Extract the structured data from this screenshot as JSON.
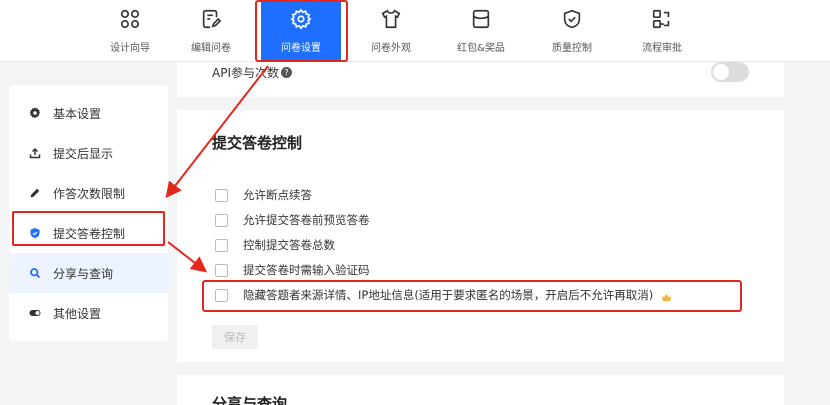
{
  "toolbar": {
    "items": [
      {
        "label": "设计向导",
        "icon": "grid-icon"
      },
      {
        "label": "编辑问卷",
        "icon": "edit-icon"
      },
      {
        "label": "问卷设置",
        "icon": "gear-icon"
      },
      {
        "label": "问卷外观",
        "icon": "shirt-icon"
      },
      {
        "label": "红包&奖品",
        "icon": "envelope-icon"
      },
      {
        "label": "质量控制",
        "icon": "shield-check-icon"
      },
      {
        "label": "流程审批",
        "icon": "flow-icon"
      }
    ],
    "active_index": 2
  },
  "sidebar": {
    "items": [
      {
        "label": "基本设置",
        "icon": "gear-icon"
      },
      {
        "label": "提交后显示",
        "icon": "upload-icon"
      },
      {
        "label": "作答次数限制",
        "icon": "pencil-icon"
      },
      {
        "label": "提交答卷控制",
        "icon": "shield-icon"
      },
      {
        "label": "分享与查询",
        "icon": "search-icon"
      },
      {
        "label": "其他设置",
        "icon": "toggle-icon"
      }
    ],
    "active_index": 3
  },
  "api": {
    "label": "API参与次数"
  },
  "submit_control": {
    "title": "提交答卷控制",
    "options": [
      "允许断点续答",
      "允许提交答卷前预览答卷",
      "控制提交答卷总数",
      "提交答卷时需输入验证码",
      "隐藏答题者来源详情、IP地址信息(适用于要求匿名的场景，开启后不允许再取消)"
    ],
    "save_label": "保存"
  },
  "next_section": {
    "title": "分享与查询"
  },
  "colors": {
    "accent": "#1e6fff",
    "highlight": "#e5271b"
  }
}
